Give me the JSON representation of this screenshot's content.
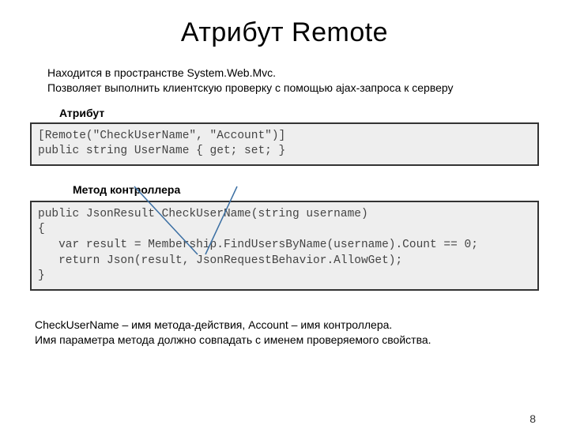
{
  "title": "Атрибут Remote",
  "intro_line1": "Находится в пространстве System.Web.Mvc.",
  "intro_line2": "Позволяет выполнить клиентскую проверку с помощью ajax-запроса к серверу",
  "label_attribute": "Атрибут",
  "code_attribute": "[Remote(\"CheckUserName\", \"Account\")]\npublic string UserName { get; set; }",
  "label_controller": "Метод контроллера",
  "code_controller": "public JsonResult CheckUserName(string username)\n{\n   var result = Membership.FindUsersByName(username).Count == 0;\n   return Json(result, JsonRequestBehavior.AllowGet);\n}",
  "notes_line1": "CheckUserName – имя метода-действия,  Account – имя контроллера.",
  "notes_line2": "Имя параметра метода должно совпадать с именем проверяемого свойства.",
  "page_number": "8"
}
